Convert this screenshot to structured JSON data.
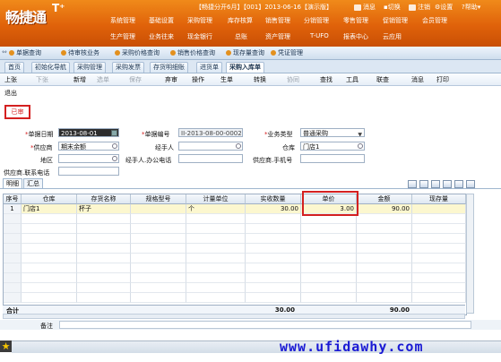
{
  "colors": {
    "brand_orange": "#e0620a",
    "highlight_red": "#d42020",
    "watermark_blue": "#1a1ad4",
    "selected_row": "#fcf7cf"
  },
  "banner": {
    "logo_text": "畅捷通",
    "logo_plus": "T⁺",
    "info": "【畅捷分开6月】【001】2013-06-16【演示版】",
    "messages": "消息",
    "logout": "注销",
    "switch": "切换",
    "settings": "设置",
    "help": "帮助",
    "nav_row1": [
      "系统管理",
      "基础设置",
      "采购管理",
      "库存核算",
      "销售管理",
      "分销管理",
      "零售管理",
      "促销管理",
      "会员管理"
    ],
    "nav_row2": [
      "生产管理",
      "业务往来",
      "现金银行",
      "总账",
      "资产管理",
      "T-UFO",
      "报表中心",
      "云应用"
    ]
  },
  "quickbar": {
    "items": [
      "单据查询",
      "待审核业务",
      "采购价格查询",
      "销售价格查询",
      "现存量查询",
      "凭证管理"
    ]
  },
  "tabs": [
    "首页",
    "初始化导航",
    "采购管理",
    "采购发票",
    "存货明细账",
    "进货单",
    "采购入库单"
  ],
  "toolbar": {
    "items": [
      "上张",
      "下张",
      "新增",
      "选单",
      "保存",
      "弃审",
      "操作",
      "生单",
      "转换",
      "协同",
      "查找",
      "工具",
      "联查",
      "消息",
      "打印"
    ],
    "exit": "退出"
  },
  "audit_status": "已审",
  "form": {
    "date_label": "单据日期",
    "date_value": "2013-08-01",
    "number_label": "单据编号",
    "number_value": "II-2013-08-00-0002",
    "biztype_label": "业务类型",
    "biztype_value": "普通采购",
    "supplier_label": "供应商",
    "supplier_value": "期末余额",
    "handler_label": "经手人",
    "handler_value": "",
    "warehouse_label": "仓库",
    "warehouse_value": "门店1",
    "region_label": "地区",
    "region_value": "",
    "office_phone_label": "经手人.办公电话",
    "office_phone_value": "",
    "supplier_mobile_label": "供应商.手机号",
    "supplier_mobile_value": "",
    "supplier_phone_label": "供应商.联系电话",
    "supplier_phone_value": ""
  },
  "detail_tabs": [
    "明细",
    "汇总"
  ],
  "grid": {
    "columns": [
      "序号",
      "仓库",
      "存货名称",
      "规格型号",
      "计量单位",
      "实收数量",
      "单价",
      "金额",
      "现存量"
    ],
    "rows": [
      {
        "no": "1",
        "warehouse": "门店1",
        "item": "杯子",
        "spec": "",
        "unit": "个",
        "qty": "30.00",
        "price": "3.00",
        "amount": "90.00",
        "stock": ""
      }
    ],
    "totals": {
      "label": "合计",
      "qty": "30.00",
      "amount": "90.00"
    }
  },
  "footer": {
    "remark_label": "备注"
  },
  "watermark": "www.ufidawhy.com"
}
